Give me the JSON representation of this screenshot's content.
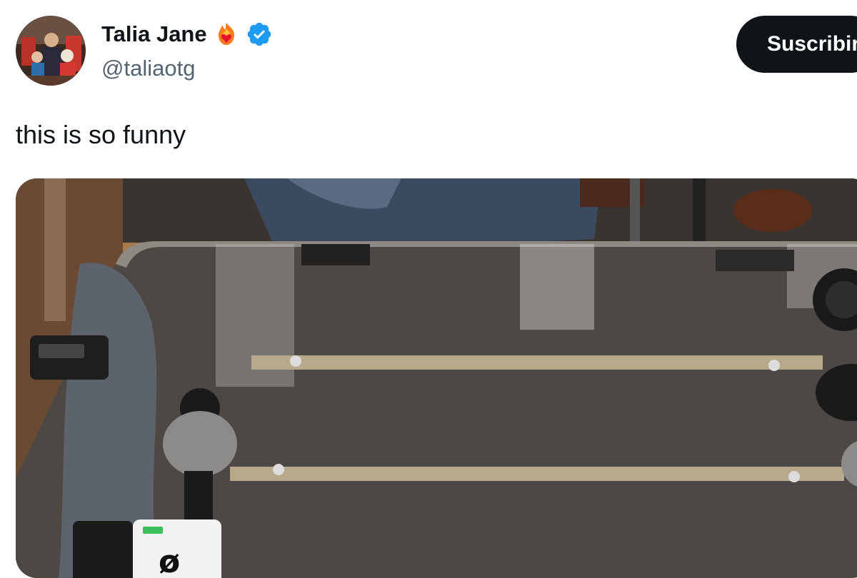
{
  "tweet": {
    "author_name": "Talia Jane",
    "author_handle": "@taliaotg",
    "text": "this is so funny",
    "badges": [
      "fire-heart-icon",
      "verified-checkmark-icon"
    ]
  },
  "subscribe_button": {
    "label": "Suscribirse"
  },
  "media": {
    "type": "photo"
  },
  "colors": {
    "text_primary": "#0f1419",
    "text_secondary": "#536471",
    "verified_blue": "#1d9bf0",
    "button_bg": "#0f1419"
  }
}
